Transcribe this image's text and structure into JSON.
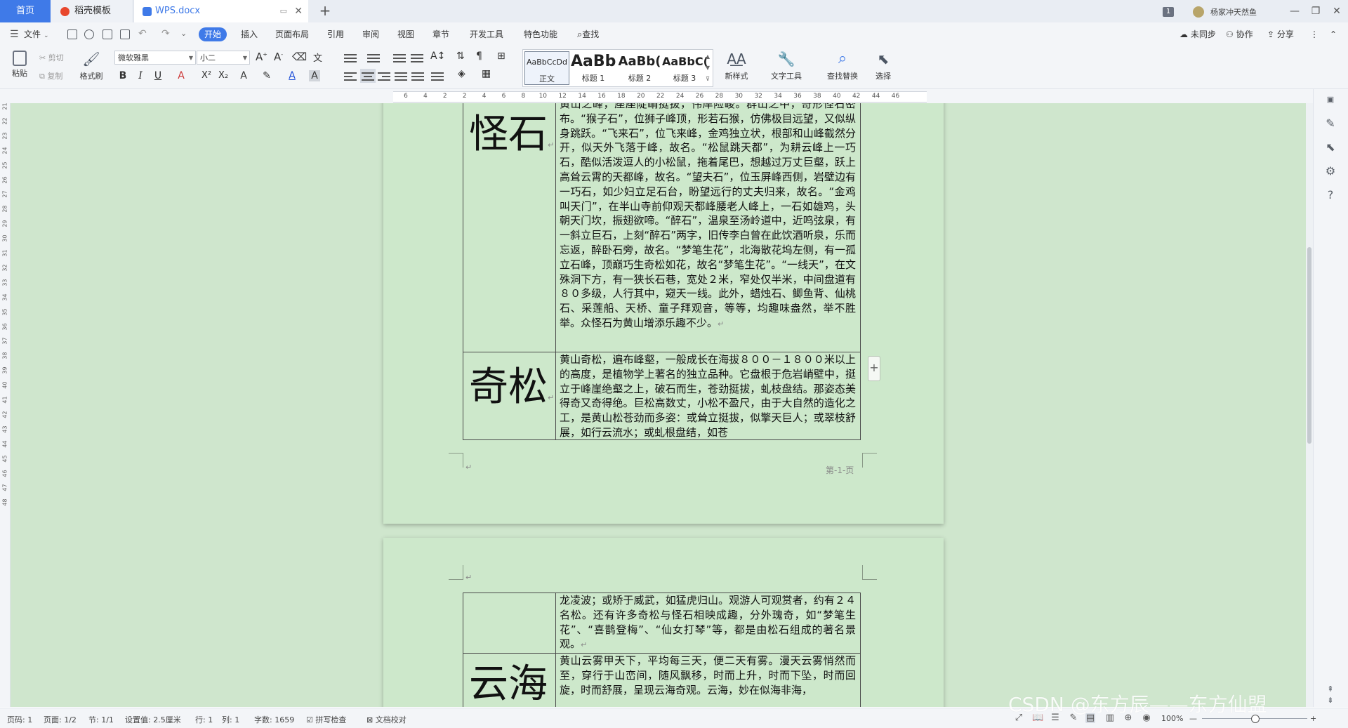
{
  "tabs": {
    "home": "首页",
    "template": "稻壳模板",
    "document": "WPS.docx"
  },
  "titlebar": {
    "badge": "1",
    "user": "杨家冲天然鱼"
  },
  "menu": {
    "file": "文件",
    "items": [
      "开始",
      "插入",
      "页面布局",
      "引用",
      "审阅",
      "视图",
      "章节",
      "开发工具",
      "特色功能"
    ],
    "search": "查找",
    "sync": "未同步",
    "collab": "协作",
    "share": "分享"
  },
  "ribbon": {
    "paste": "粘贴",
    "cut": "剪切",
    "copy": "复制",
    "format_painter": "格式刷",
    "font_name": "微软雅黑",
    "font_size": "小二",
    "bold": "B",
    "italic": "I",
    "underline": "U",
    "styles": [
      {
        "sample": "AaBbCcDd",
        "label": "正文"
      },
      {
        "sample": "AaBb",
        "label": "标题 1"
      },
      {
        "sample": "AaBb(",
        "label": "标题 2"
      },
      {
        "sample": "AaBbC(",
        "label": "标题 3"
      }
    ],
    "new_style": "新样式",
    "text_tools": "文字工具",
    "find_replace": "查找替换",
    "select": "选择"
  },
  "ruler": {
    "h": [
      "6",
      "4",
      "2",
      "2",
      "4",
      "6",
      "8",
      "10",
      "12",
      "14",
      "16",
      "18",
      "20",
      "22",
      "24",
      "26",
      "28",
      "30",
      "32",
      "34",
      "36",
      "38",
      "40",
      "42",
      "44",
      "46"
    ],
    "v": [
      "21",
      "22",
      "23",
      "24",
      "25",
      "26",
      "27",
      "28",
      "29",
      "30",
      "31",
      "32",
      "33",
      "34",
      "35",
      "36",
      "37",
      "38",
      "39",
      "40",
      "41",
      "42",
      "43",
      "44",
      "45",
      "46",
      "47",
      "48"
    ]
  },
  "document": {
    "row1_title": "怪石",
    "row1_text": "黄山之峰，座座陡峭挺拔，伟岸险峻。群山之中，奇形怪石密布。“猴子石”，位狮子峰顶，形若石猴，仿佛极目远望，又似纵身跳跃。“飞来石”，位飞来峰，金鸡独立状，根部和山峰截然分开，似天外飞落于峰，故名。“松鼠跳天都”，为耕云峰上一巧石，酷似活泼逗人的小松鼠，拖着尾巴，想越过万丈巨壑，跃上高耸云霄的天都峰，故名。“望夫石”，位玉屏峰西侧，岩壁边有一巧石，如少妇立足石台，盼望远行的丈夫归来，故名。“金鸡叫天门”，在半山寺前仰观天都峰腰老人峰上，一石如雄鸡，头朝天门坎，振翅欲啼。“醉石”，温泉至汤岭道中，近鸣弦泉，有一斜立巨石，上刻“醉石”两字，旧传李白曾在此饮酒听泉，乐而忘返，醉卧石旁，故名。“梦笔生花”，北海散花坞左侧，有一孤立石峰，顶巅巧生奇松如花，故名“梦笔生花”。“一线天”，在文殊洞下方，有一狭长石巷，宽处２米，窄处仅半米，中间盘道有８０多级，人行其中，窥天一线。此外，蜡烛石、鲫鱼背、仙桃石、采莲船、天桥、童子拜观音，等等，均趣味盎然，举不胜举。众怪石为黄山增添乐趣不少。",
    "row2_title": "奇松",
    "row2_text": "黄山奇松，遍布峰壑，一般成长在海拔８００－１８００米以上的高度，是植物学上著名的独立品种。它盘根于危岩峭壁中，挺立于峰崖绝壑之上，破石而生，苍劲挺拔，虬枝盘结。那姿态美得奇又奇得绝。巨松高数丈，小松不盈尺，由于大自然的造化之工，是黄山松苍劲而多姿：或耸立挺拔，似擎天巨人；或翠枝舒展，如行云流水；或虬根盘结，如苍",
    "page_footer": "第-1-页",
    "row3_text": "龙凌波；或矫于威武，如猛虎归山。观游人可观赏者，约有２４名松。还有许多奇松与怪石相映成趣，分外瑰奇，如“梦笔生花”、“喜鹊登梅”、“仙女打琴”等，都是由松石组成的著名景观。",
    "row4_title": "云海",
    "row4_text": "黄山云雾甲天下，平均每三天，便二天有雾。漫天云雾悄然而至，穿行于山峦间，随风飘移，时而上升，时而下坠，时而回旋，时而舒展，呈现云海奇观。云海，妙在似海非海，"
  },
  "status": {
    "page_code": "页码: 1",
    "page": "页面: 1/2",
    "section": "节: 1/1",
    "setting": "设置值: 2.5厘米",
    "line": "行: 1",
    "col": "列: 1",
    "words": "字数: 1659",
    "spell": "拼写检查",
    "proof": "文档校对",
    "zoom": "100%",
    "watermark": "CSDN @东方辰——东方仙盟"
  },
  "colors": {
    "accent": "#3f7ae8",
    "doc_background": "#cfe6cd",
    "page": "#cde8cb"
  }
}
